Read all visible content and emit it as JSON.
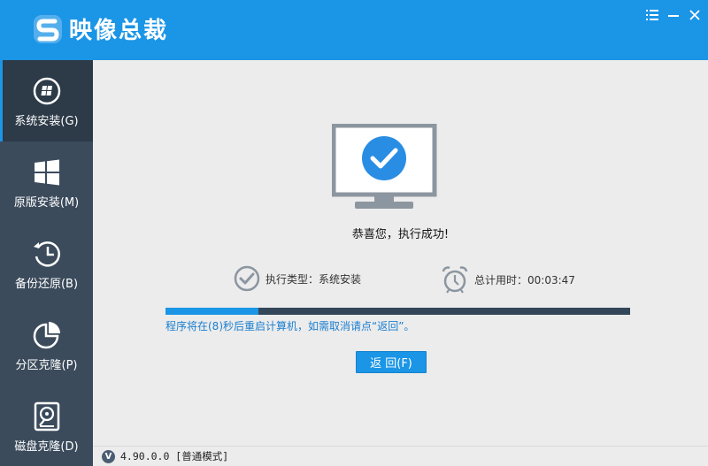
{
  "app": {
    "title": "映像总裁",
    "brand_color": "#1b95e6"
  },
  "window_controls": {
    "menu_icon": "menu-icon",
    "minimize_icon": "minimize-icon",
    "close_icon": "close-icon"
  },
  "sidebar": {
    "items": [
      {
        "label": "系统安装(G)",
        "icon": "windows-disc-icon",
        "active": true
      },
      {
        "label": "原版安装(M)",
        "icon": "windows-logo-icon",
        "active": false
      },
      {
        "label": "备份还原(B)",
        "icon": "clock-restore-icon",
        "active": false
      },
      {
        "label": "分区克隆(P)",
        "icon": "pie-chart-icon",
        "active": false
      },
      {
        "label": "磁盘克隆(D)",
        "icon": "disk-icon",
        "active": false
      }
    ]
  },
  "main": {
    "success_message": "恭喜您，执行成功!",
    "exec_type_label": "执行类型：系统安装",
    "total_time_label": "总计用时：00:03:47",
    "progress_fraction": 0.2,
    "countdown_text": "程序将在(8)秒后重启计算机，如需取消请点“返回”。",
    "back_button_label": "返 回(F)"
  },
  "status": {
    "version_badge": "V",
    "version_text": "4.90.0.0 [普通模式]"
  }
}
